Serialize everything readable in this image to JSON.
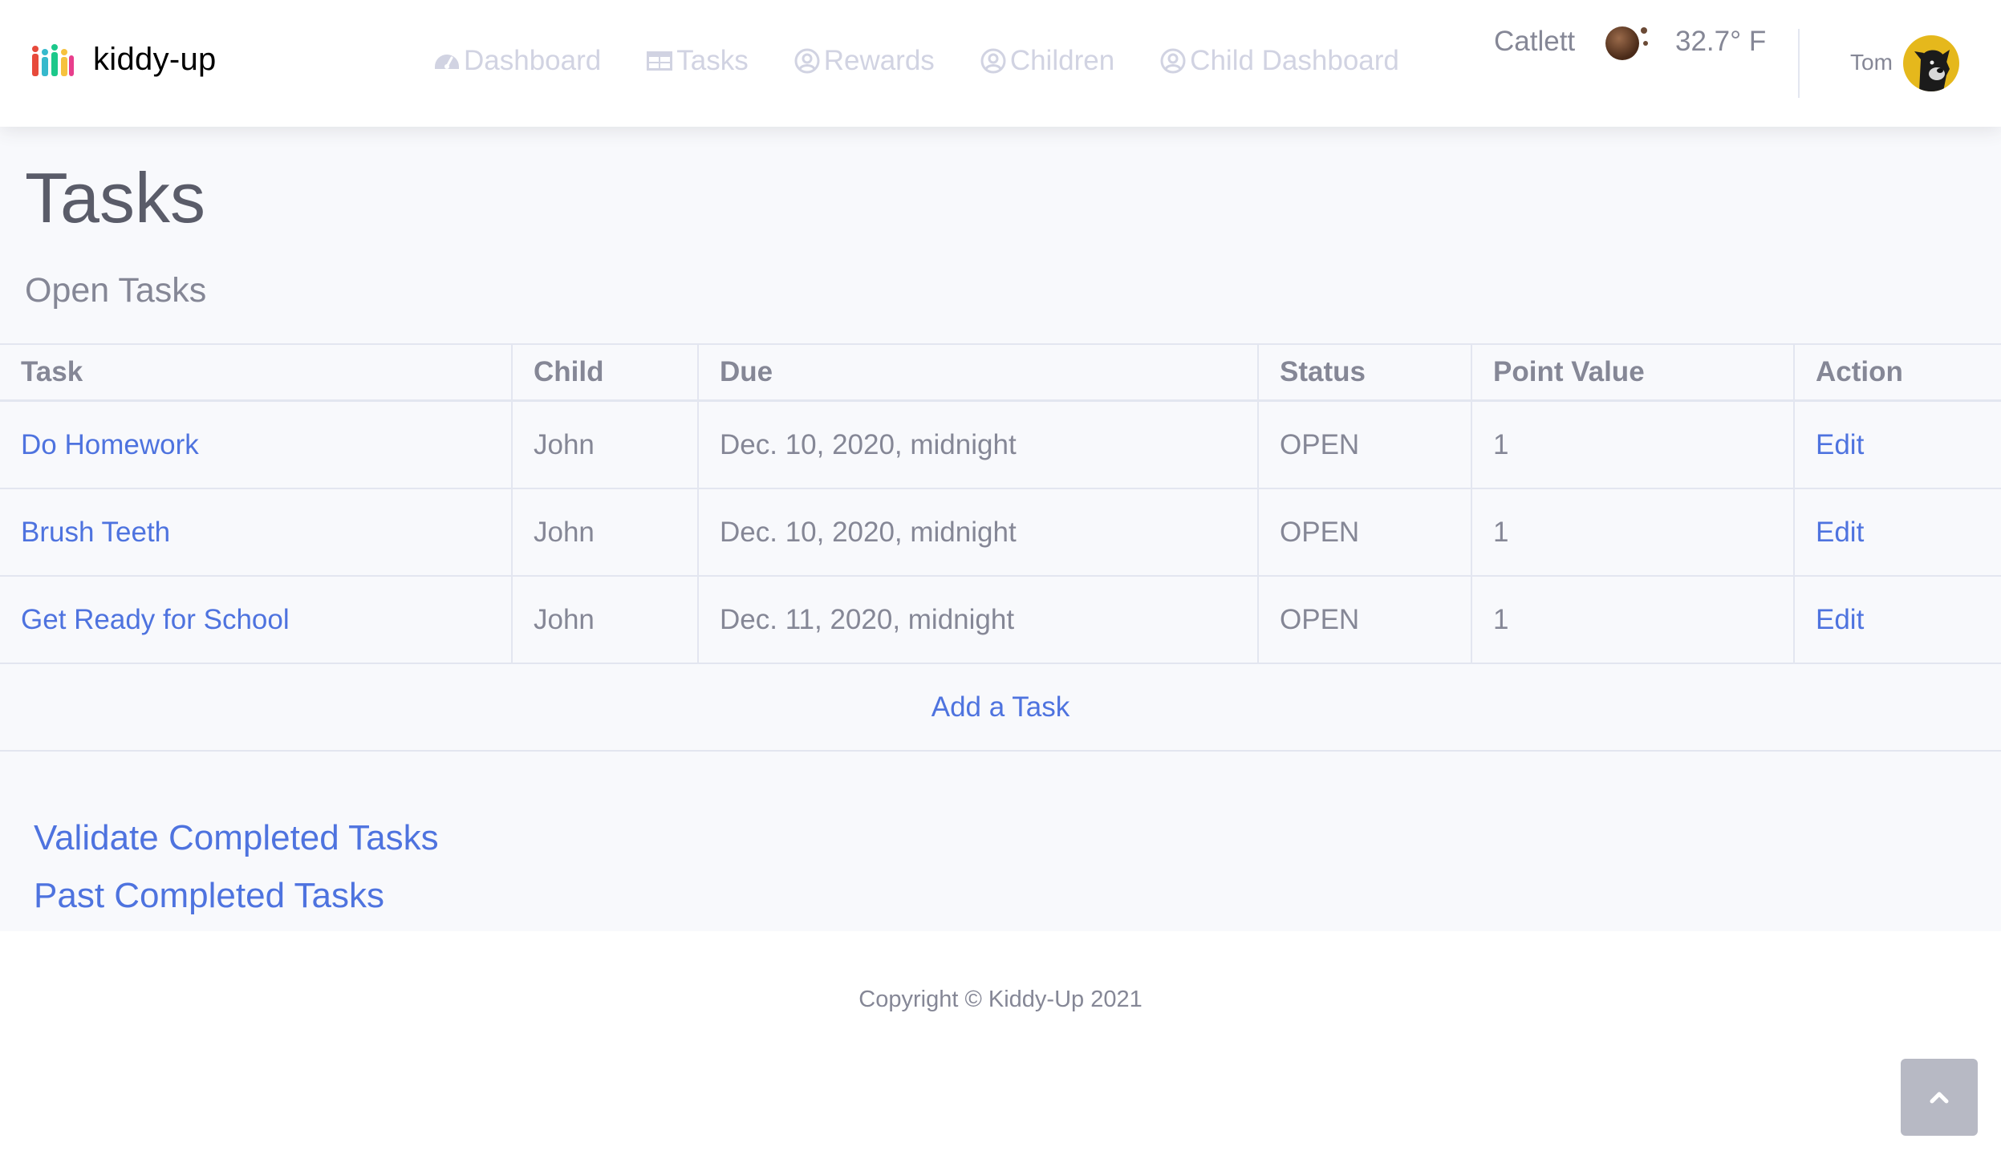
{
  "brand": {
    "name": "kiddy-up",
    "logo_icon": "family-logo-icon"
  },
  "nav": {
    "items": [
      {
        "label": "Dashboard",
        "icon": "speedometer-icon"
      },
      {
        "label": "Tasks",
        "icon": "table-icon"
      },
      {
        "label": "Rewards",
        "icon": "user-circle-icon"
      },
      {
        "label": "Children",
        "icon": "user-circle-icon"
      },
      {
        "label": "Child Dashboard",
        "icon": "user-circle-icon"
      }
    ]
  },
  "weather": {
    "city": "Catlett",
    "temperature": "32.7° F",
    "icon": "weather-icon"
  },
  "user": {
    "name": "Tom",
    "avatar": "avatar-dog"
  },
  "page": {
    "title": "Tasks",
    "section_title": "Open Tasks"
  },
  "table": {
    "headers": [
      "Task",
      "Child",
      "Due",
      "Status",
      "Point Value",
      "Action"
    ],
    "rows": [
      {
        "task": "Do Homework",
        "child": "John",
        "due": "Dec. 10, 2020, midnight",
        "status": "OPEN",
        "points": "1",
        "action": "Edit"
      },
      {
        "task": "Brush Teeth",
        "child": "John",
        "due": "Dec. 10, 2020, midnight",
        "status": "OPEN",
        "points": "1",
        "action": "Edit"
      },
      {
        "task": "Get Ready for School",
        "child": "John",
        "due": "Dec. 11, 2020, midnight",
        "status": "OPEN",
        "points": "1",
        "action": "Edit"
      }
    ],
    "add_label": "Add a Task"
  },
  "links": {
    "validate": "Validate Completed Tasks",
    "past": "Past Completed Tasks"
  },
  "footer": {
    "copyright": "Copyright © Kiddy-Up 2021"
  },
  "colors": {
    "link": "#4e73df",
    "text": "#858796",
    "nav_inactive": "#d1d3e2",
    "content_bg": "#f8f9fc"
  }
}
